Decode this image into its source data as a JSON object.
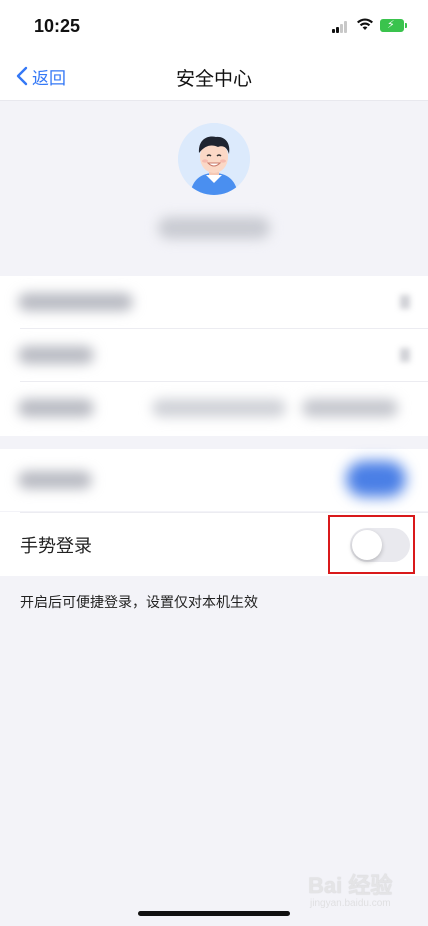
{
  "status_bar": {
    "time": "10:25",
    "icons": [
      "signal-icon",
      "wifi-icon",
      "battery-charging-icon"
    ],
    "battery_color": "#3ac34d"
  },
  "nav": {
    "back_label": "返回",
    "title": "安全中心",
    "accent_color": "#3478f6"
  },
  "settings": {
    "gesture_login": {
      "label": "手势登录",
      "enabled": false
    },
    "hint": "开启后可便捷登录，设置仅对本机生效"
  },
  "annotation": {
    "highlight_color": "#d9191b"
  },
  "watermark": {
    "logo_text": "Bai 经验",
    "sub_text": "jingyan.baidu.com"
  }
}
